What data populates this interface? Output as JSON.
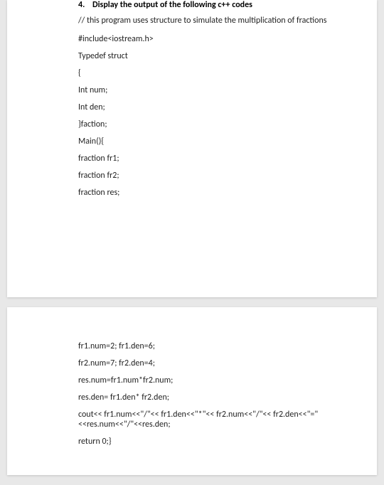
{
  "heading": {
    "number": "4.",
    "title": "Display the output of the following c++ codes"
  },
  "page1_lines": [
    "// this program uses structure to simulate the multiplication of fractions",
    "#include<iostream.h>",
    "Typedef struct",
    "{",
    "Int num;",
    "Int den;",
    "}faction;",
    "Main(){",
    "fraction fr1;",
    "fraction fr2;",
    "fraction res;"
  ],
  "page2_lines": [
    "fr1.num=2; fr1.den=6;",
    "fr2.num=7; fr2.den=4;",
    "res.num=fr1.num*fr2.num;",
    "res.den= fr1.den* fr2.den;",
    "cout<< fr1.num<<\"/\"<< fr1.den<<\"*\"<< fr2.num<<\"/\"<< fr2.den<<\"=\"<<res.num<<\"/\"<<res.den;",
    "return 0;}"
  ]
}
